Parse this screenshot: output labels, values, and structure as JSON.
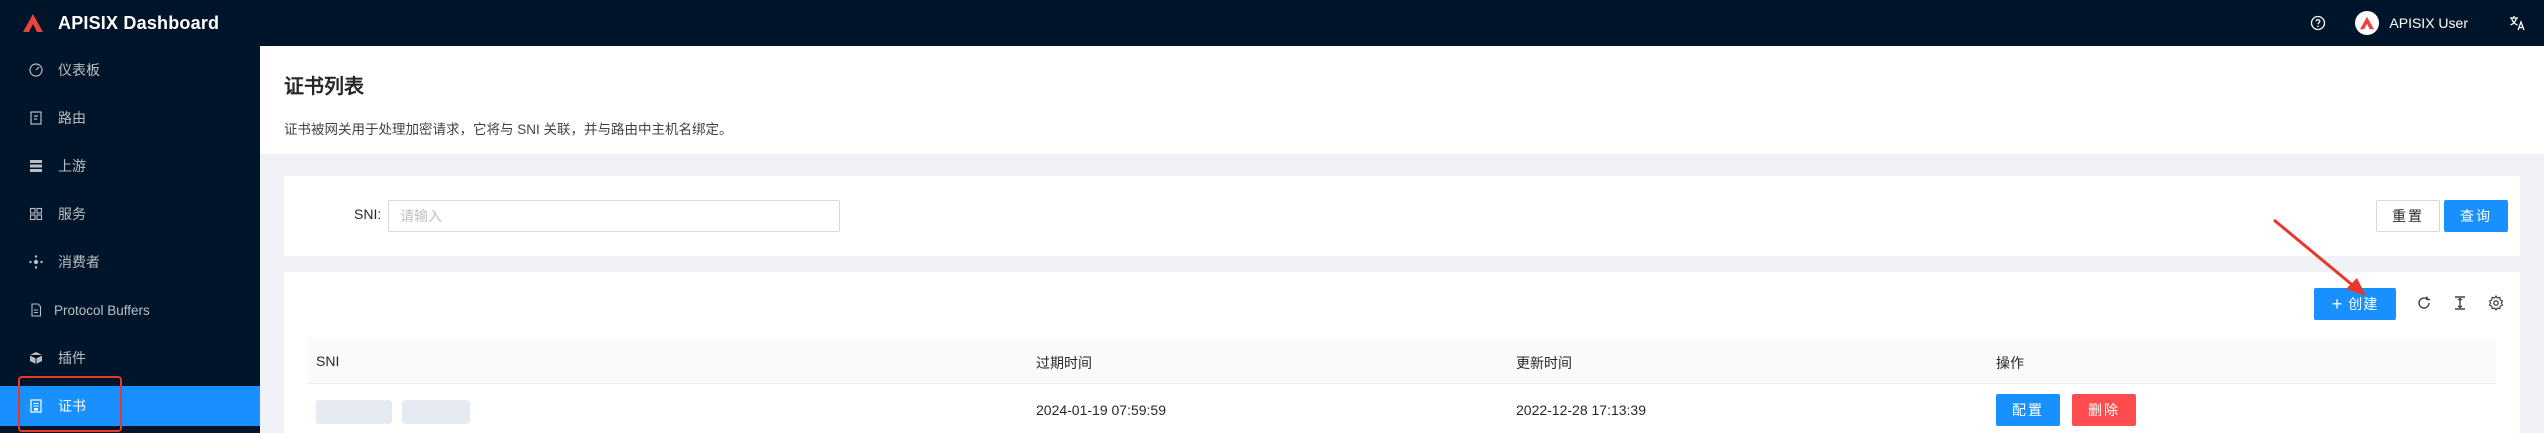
{
  "header": {
    "app_title": "APISIX Dashboard",
    "user_name": "APISIX User",
    "icons": [
      "apisix-logo-icon",
      "question-circle-icon",
      "user-avatar-icon",
      "translate-icon"
    ]
  },
  "sidebar": {
    "items": [
      {
        "label": "仪表板",
        "icon": "dashboard-icon"
      },
      {
        "label": "路由",
        "icon": "route-icon"
      },
      {
        "label": "上游",
        "icon": "upstream-icon"
      },
      {
        "label": "服务",
        "icon": "service-icon"
      },
      {
        "label": "消费者",
        "icon": "consumer-icon"
      },
      {
        "label": "Protocol Buffers",
        "icon": "file-icon"
      },
      {
        "label": "插件",
        "icon": "plugin-icon"
      },
      {
        "label": "证书",
        "icon": "certificate-icon",
        "active": true
      }
    ]
  },
  "page": {
    "title": "证书列表",
    "description": "证书被网关用于处理加密请求，它将与 SNI 关联，并与路由中主机名绑定。"
  },
  "search": {
    "sni_label": "SNI:",
    "sni_placeholder": "请输入",
    "reset_label": "重置",
    "query_label": "查询"
  },
  "toolbar": {
    "create_label": "创建",
    "icons": [
      "reload-icon",
      "column-height-icon",
      "setting-icon"
    ]
  },
  "table": {
    "columns": [
      "SNI",
      "过期时间",
      "更新时间",
      "操作"
    ],
    "rows": [
      {
        "sni": "",
        "expire_time": "2024-01-19 07:59:59",
        "update_time": "2022-12-28 17:13:39",
        "actions": {
          "edit": "配置",
          "delete": "删除"
        }
      }
    ]
  },
  "colors": {
    "sidebar_bg": "#001529",
    "primary": "#1890ff",
    "danger": "#ff4d4f",
    "annotation": "#e8372b"
  }
}
